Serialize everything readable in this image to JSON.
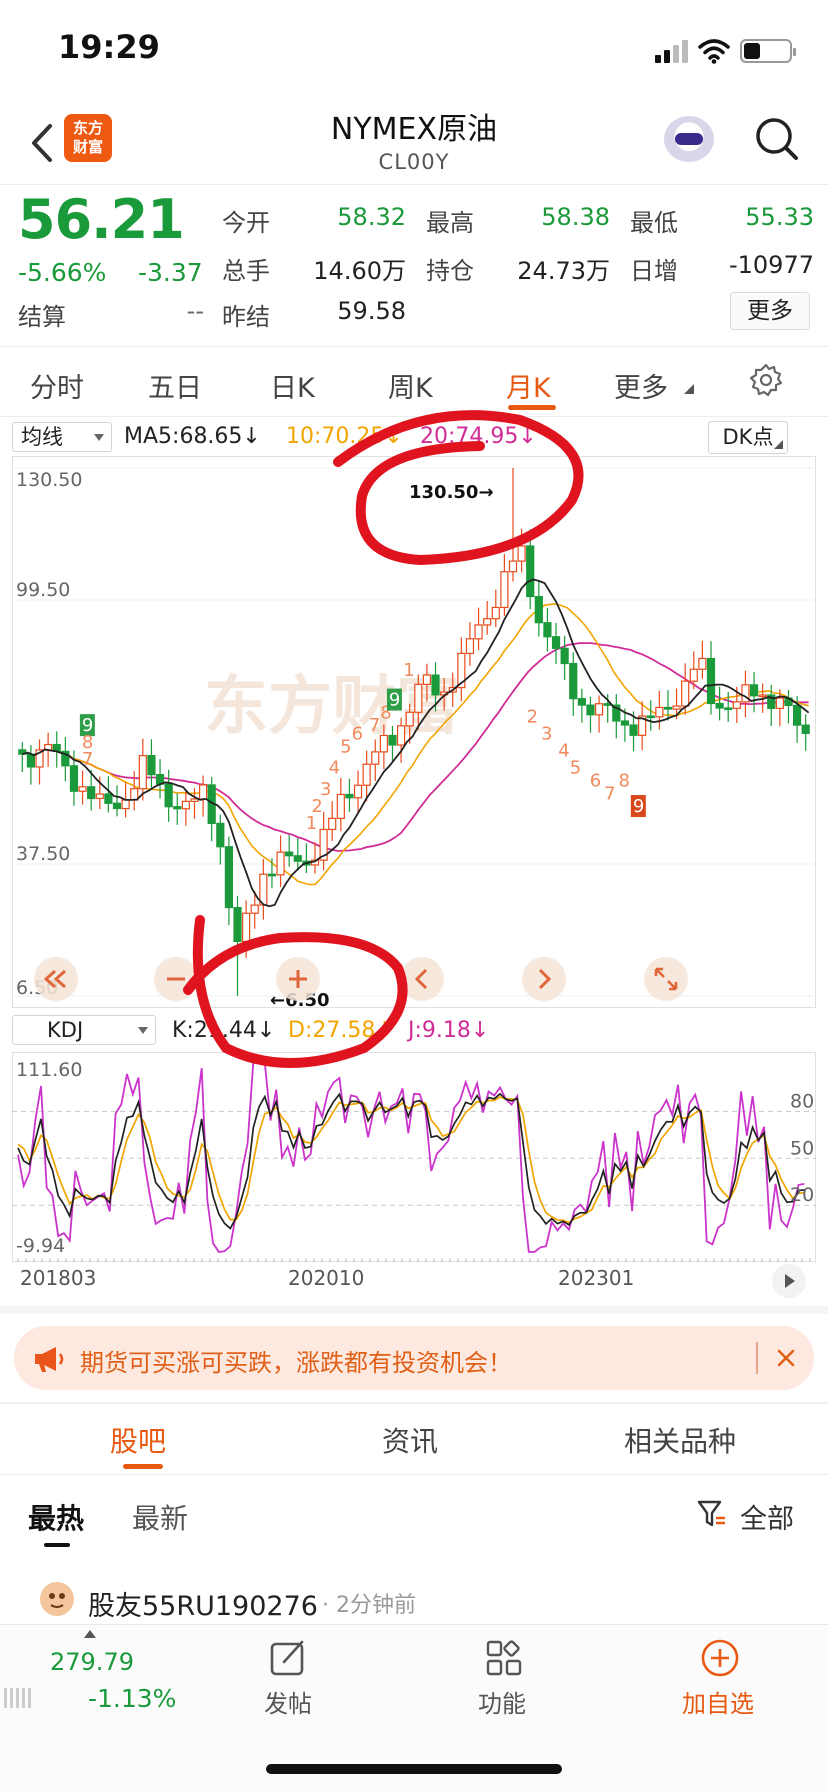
{
  "status_bar": {
    "time": "19:29"
  },
  "header": {
    "logo_text": "东方\n财富",
    "title": "NYMEX原油",
    "subtitle": "CL00Y"
  },
  "quote": {
    "price": "56.21",
    "change_pct": "-5.66%",
    "change": "-3.37",
    "settle_label": "结算",
    "settle_value": "--",
    "open_label": "今开",
    "open_value": "58.32",
    "high_label": "最高",
    "high_value": "58.38",
    "low_label": "最低",
    "low_value": "55.33",
    "volume_label": "总手",
    "volume_value": "14.60万",
    "oi_label": "持仓",
    "oi_value": "24.73万",
    "oi_change_label": "日增",
    "oi_change_value": "-10977",
    "prev_settle_label": "昨结",
    "prev_settle_value": "59.58",
    "more_label": "更多"
  },
  "period_tabs": [
    {
      "label": "分时"
    },
    {
      "label": "五日"
    },
    {
      "label": "日K"
    },
    {
      "label": "周K"
    },
    {
      "label": "月K",
      "active": true
    },
    {
      "label": "更多"
    }
  ],
  "indicators": {
    "ma_select": "均线",
    "ma5": "MA5:68.65↓",
    "ma10": "10:70.25↓",
    "ma20": "20:74.95↓",
    "dk_label": "DK点",
    "kdj_select": "KDJ",
    "k": "K:21.44↓",
    "d": "D:27.58↓",
    "j": "J:9.18↓"
  },
  "colors": {
    "up": "#e84b1a",
    "down": "#1a9a3a",
    "accent": "#e85a12",
    "ma5": "#222222",
    "ma10": "#f2a400",
    "ma20": "#d02c96",
    "annotation": "#e0141e"
  },
  "chart_data": [
    {
      "type": "candlestick",
      "ylim": [
        6.5,
        130.5
      ],
      "y_ticks": [
        "130.50",
        "99.50",
        "37.50",
        "6.50"
      ],
      "max_label": "130.50→",
      "min_label": "←6.50",
      "x": [
        "201803",
        "202010",
        "202301"
      ],
      "series": [
        {
          "name": "MA5",
          "value": 68.65
        },
        {
          "name": "10",
          "value": 70.25
        },
        {
          "name": "20",
          "value": 74.95
        }
      ],
      "marker_labels": [
        "9",
        "8",
        "7",
        "1",
        "2",
        "3",
        "4",
        "5",
        "6",
        "7",
        "8",
        "9",
        "1",
        "2",
        "3",
        "4",
        "5",
        "6",
        "7",
        "8",
        "9"
      ]
    },
    {
      "type": "line",
      "ylim": [
        -9.94,
        111.6
      ],
      "y_ticks": [
        "111.60",
        "-9.94"
      ],
      "right_ticks": [
        "80",
        "50",
        "20"
      ],
      "series": [
        {
          "name": "K",
          "value": 21.44
        },
        {
          "name": "D",
          "value": 27.58
        },
        {
          "name": "J",
          "value": 9.18
        }
      ]
    }
  ],
  "banner": {
    "text": "期货可买涨可买跌，涨跌都有投资机会！"
  },
  "content_tabs": [
    {
      "label": "股吧",
      "active": true
    },
    {
      "label": "资讯"
    },
    {
      "label": "相关品种"
    }
  ],
  "sort_tabs": [
    {
      "label": "最热",
      "active": true
    },
    {
      "label": "最新"
    }
  ],
  "filter_label": "全部",
  "post": {
    "author": "股友55RU190276",
    "time": "· 2分钟前"
  },
  "bottom_bar": {
    "index_value": "279.79",
    "index_pct": "-1.13%",
    "items": [
      {
        "label": "发帖"
      },
      {
        "label": "功能"
      },
      {
        "label": "加自选"
      }
    ]
  }
}
